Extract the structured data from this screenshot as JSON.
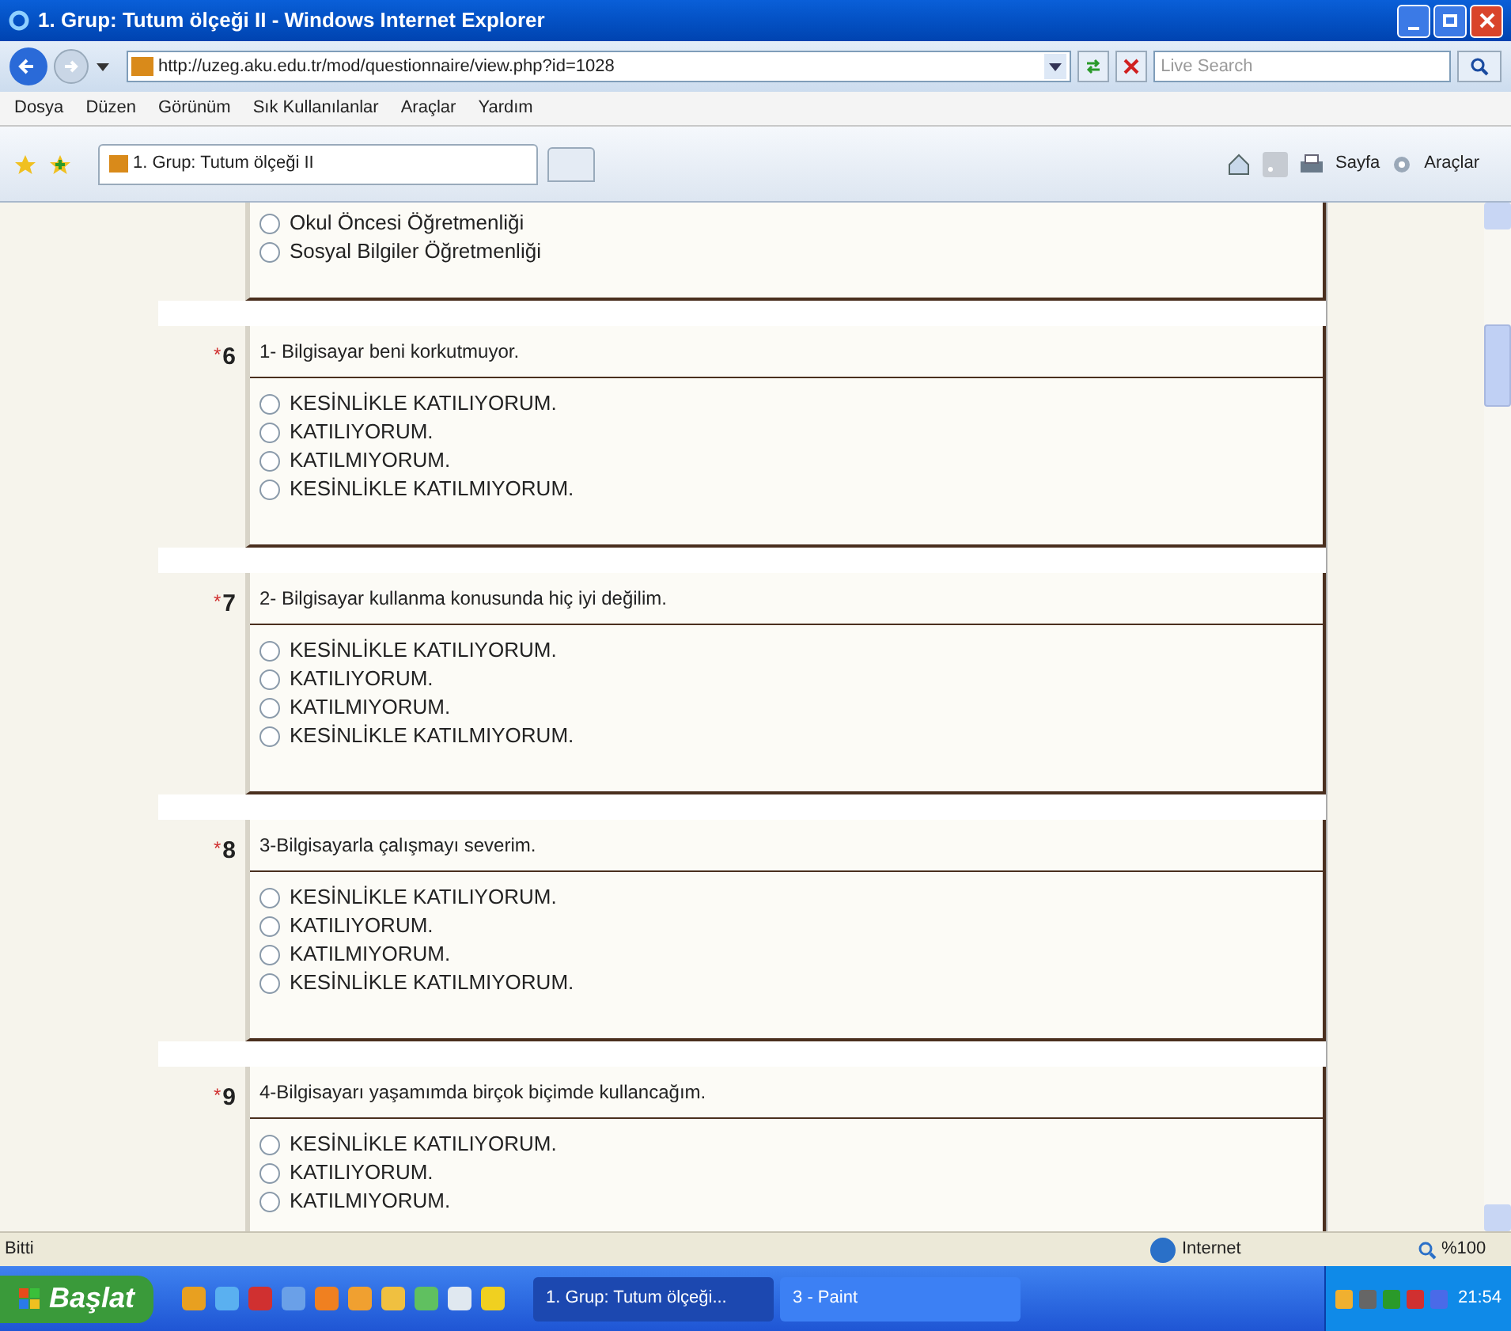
{
  "window": {
    "title": "1. Grup: Tutum ölçeği II - Windows Internet Explorer"
  },
  "address_bar": {
    "url": "http://uzeg.aku.edu.tr/mod/questionnaire/view.php?id=1028",
    "search_placeholder": "Live Search"
  },
  "menu": [
    "Dosya",
    "Düzen",
    "Görünüm",
    "Sık Kullanılanlar",
    "Araçlar",
    "Yardım"
  ],
  "tabs": [
    {
      "label": "1. Grup: Tutum ölçeği II",
      "selected": true
    }
  ],
  "command_bar": [
    "Sayfa",
    "Araçlar"
  ],
  "previous_options": [
    {
      "label": "Okul Öncesi Öğretmenliği",
      "selected": false
    },
    {
      "label": "Sosyal Bilgiler Öğretmenliği",
      "selected": false
    }
  ],
  "questions": [
    {
      "required_mark": "*",
      "number": "6",
      "text": "1- Bilgisayar beni korkutmuyor.",
      "options": [
        {
          "label": "KESİNLİKLE KATILIYORUM.",
          "selected": false
        },
        {
          "label": "KATILIYORUM.",
          "selected": false
        },
        {
          "label": "KATILMIYORUM.",
          "selected": false
        },
        {
          "label": "KESİNLİKLE KATILMIYORUM.",
          "selected": false
        }
      ]
    },
    {
      "required_mark": "*",
      "number": "7",
      "text": "2- Bilgisayar kullanma konusunda hiç iyi değilim.",
      "options": [
        {
          "label": "KESİNLİKLE KATILIYORUM.",
          "selected": false
        },
        {
          "label": "KATILIYORUM.",
          "selected": false
        },
        {
          "label": "KATILMIYORUM.",
          "selected": false
        },
        {
          "label": "KESİNLİKLE KATILMIYORUM.",
          "selected": false
        }
      ]
    },
    {
      "required_mark": "*",
      "number": "8",
      "text": "3-Bilgisayarla çalışmayı severim.",
      "options": [
        {
          "label": "KESİNLİKLE KATILIYORUM.",
          "selected": false
        },
        {
          "label": "KATILIYORUM.",
          "selected": false
        },
        {
          "label": "KATILMIYORUM.",
          "selected": false
        },
        {
          "label": "KESİNLİKLE KATILMIYORUM.",
          "selected": false
        }
      ]
    },
    {
      "required_mark": "*",
      "number": "9",
      "text": "4-Bilgisayarı yaşamımda birçok biçimde kullancağım.",
      "options": [
        {
          "label": "KESİNLİKLE KATILIYORUM.",
          "selected": false
        },
        {
          "label": "KATILIYORUM.",
          "selected": false
        },
        {
          "label": "KATILMIYORUM.",
          "selected": false
        }
      ]
    }
  ],
  "status_bar": {
    "text": "Bitti",
    "zone": "Internet",
    "zoom": "%100"
  },
  "taskbar": {
    "start": "Başlat",
    "windows": [
      {
        "label": "1. Grup: Tutum ölçeği...",
        "selected": true
      },
      {
        "label": "3 - Paint",
        "selected": false
      }
    ],
    "clock": "21:54"
  }
}
